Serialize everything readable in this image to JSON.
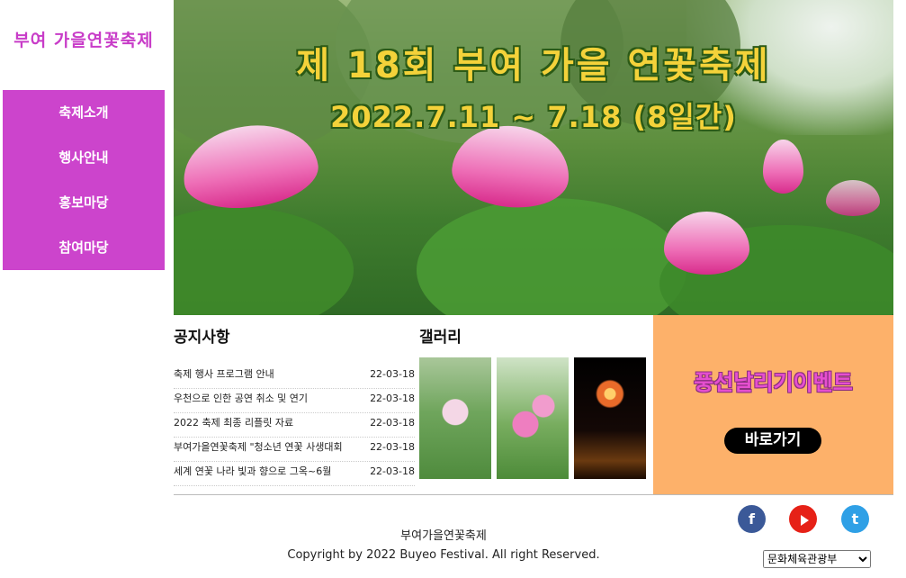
{
  "logo": "부여 가을연꽃축제",
  "nav": {
    "items": [
      "축제소개",
      "행사안내",
      "홍보마당",
      "참여마당"
    ]
  },
  "hero": {
    "title": "제 18회 부여 가을 연꽃축제",
    "date": "2022.7.11 ~ 7.18 (8일간)"
  },
  "notice": {
    "title": "공지사항",
    "items": [
      {
        "title": "축제 행사 프로그램 안내",
        "date": "22-03-18"
      },
      {
        "title": "우천으로 인한 공연 취소 및 연기",
        "date": "22-03-18"
      },
      {
        "title": "2022 축제 최종 리플릿 자료",
        "date": "22-03-18"
      },
      {
        "title": "부여가을연꽃축제 \"청소년 연꽃 사생대회",
        "date": "22-03-18"
      },
      {
        "title": "세계 연꽃 나라 빛과 향으로 그옥~6월",
        "date": "22-03-18"
      }
    ]
  },
  "gallery": {
    "title": "갤러리"
  },
  "event": {
    "title": "풍선날리기이벤트",
    "button": "바로가기"
  },
  "footer": {
    "name": "부여가을연꽃축제",
    "copyright": "Copyright by 2022 Buyeo Festival. All right Reserved.",
    "sns": {
      "facebook": "f",
      "twitter": "t"
    },
    "select": {
      "value": "문화체육관광부"
    }
  },
  "colors": {
    "nav": "#cc44cc",
    "event_bg": "#fdb16a",
    "hero_text": "#f4d23a"
  }
}
